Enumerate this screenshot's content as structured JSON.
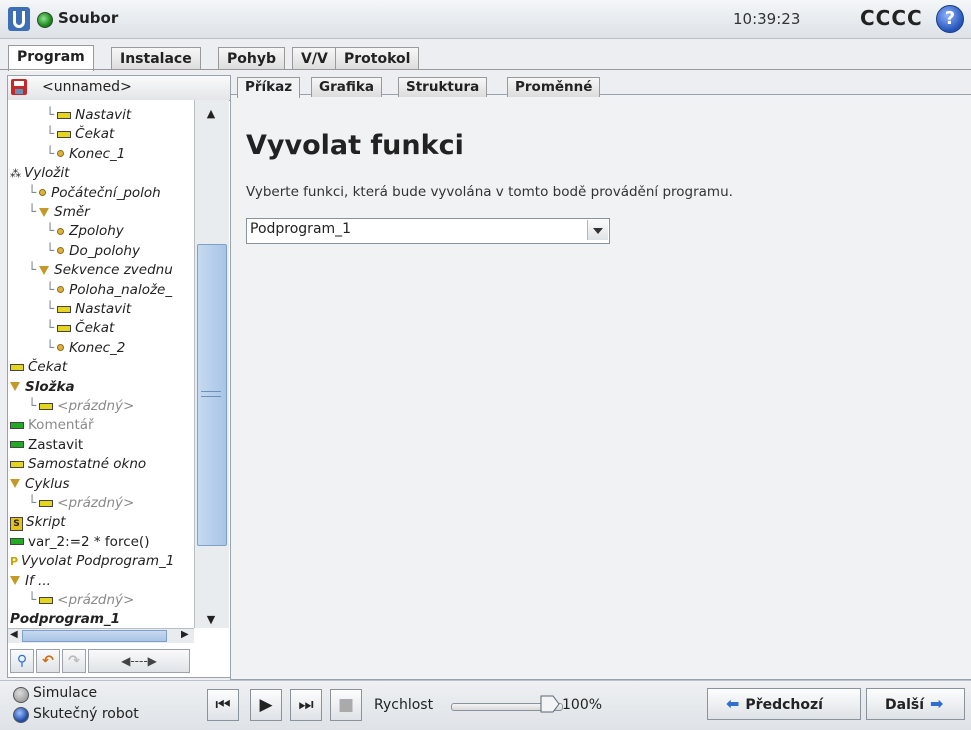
{
  "header": {
    "file_label": "Soubor",
    "clock": "10:39:23",
    "robot_name": "CCCC",
    "help_label": "?"
  },
  "main_tabs": [
    {
      "label": "Program",
      "active": true
    },
    {
      "label": "Instalace",
      "active": false
    },
    {
      "label": "Pohyb",
      "active": false
    },
    {
      "label": "V/V",
      "active": false
    },
    {
      "label": "Protokol",
      "active": false
    }
  ],
  "left": {
    "program_name": "<unnamed>",
    "tree": [
      {
        "text": "Nastavit",
        "indent": 2,
        "icon": "bar-yellow",
        "style": "it"
      },
      {
        "text": "Čekat",
        "indent": 2,
        "icon": "bar-yellow",
        "style": "it"
      },
      {
        "text": "Konec_1",
        "indent": 2,
        "icon": "dot",
        "style": "it"
      },
      {
        "text": "Vyložit",
        "indent": 0,
        "icon": "pallet",
        "style": "it"
      },
      {
        "text": "Počáteční_poloh",
        "indent": 1,
        "icon": "dot",
        "style": "it"
      },
      {
        "text": "Směr",
        "indent": 1,
        "icon": "triangle",
        "style": "it"
      },
      {
        "text": "Zpolohy",
        "indent": 2,
        "icon": "dot",
        "style": "it"
      },
      {
        "text": "Do_polohy",
        "indent": 2,
        "icon": "dot",
        "style": "it"
      },
      {
        "text": "Sekvence zvednu",
        "indent": 1,
        "icon": "triangle",
        "style": "it"
      },
      {
        "text": "Poloha_nalože_",
        "indent": 2,
        "icon": "dot",
        "style": "it"
      },
      {
        "text": "Nastavit",
        "indent": 2,
        "icon": "bar-yellow",
        "style": "it"
      },
      {
        "text": "Čekat",
        "indent": 2,
        "icon": "bar-yellow",
        "style": "it"
      },
      {
        "text": "Konec_2",
        "indent": 2,
        "icon": "dot",
        "style": "it"
      },
      {
        "text": "Čekat",
        "indent": 0,
        "icon": "bar-yellow",
        "style": "it"
      },
      {
        "text": "Složka",
        "indent": 0,
        "icon": "triangle",
        "style": "it bd"
      },
      {
        "text": "<prázdný>",
        "indent": 1,
        "icon": "bar-yellow",
        "style": "it gr"
      },
      {
        "text": "Komentář",
        "indent": 0,
        "icon": "bar-green",
        "style": "gr"
      },
      {
        "text": "Zastavit",
        "indent": 0,
        "icon": "bar-green",
        "style": ""
      },
      {
        "text": "Samostatné okno",
        "indent": 0,
        "icon": "bar-yellow",
        "style": "it"
      },
      {
        "text": "Cyklus",
        "indent": 0,
        "icon": "triangle",
        "style": "it"
      },
      {
        "text": "<prázdný>",
        "indent": 1,
        "icon": "bar-yellow",
        "style": "it gr"
      },
      {
        "text": "Skript",
        "indent": 0,
        "icon": "script",
        "style": "it"
      },
      {
        "text": "var_2:=2 * force()",
        "indent": 0,
        "icon": "bar-green",
        "style": ""
      },
      {
        "text": "Vyvolat Podprogram_1",
        "indent": 0,
        "icon": "call",
        "style": "it"
      },
      {
        "text": "If ...",
        "indent": 0,
        "icon": "triangle",
        "style": "it"
      },
      {
        "text": "<prázdný>",
        "indent": 1,
        "icon": "bar-yellow",
        "style": "it gr"
      },
      {
        "text": "Podprogram_1",
        "indent": 0,
        "icon": "none",
        "style": "it bd"
      }
    ]
  },
  "sub_tabs": [
    {
      "label": "Příkaz",
      "active": true
    },
    {
      "label": "Grafika",
      "active": false
    },
    {
      "label": "Struktura",
      "active": false
    },
    {
      "label": "Proměnné",
      "active": false
    }
  ],
  "content": {
    "title": "Vyvolat funkci",
    "description": "Vyberte funkci, která bude vyvolána v tomto bodě provádění programu.",
    "function_select_value": "Podprogram_1"
  },
  "bottom": {
    "simulation_label": "Simulace",
    "real_robot_label": "Skutečný robot",
    "speed_label": "Rychlost",
    "speed_value": "100%",
    "prev_label": "Předchozí",
    "next_label": "Další"
  }
}
